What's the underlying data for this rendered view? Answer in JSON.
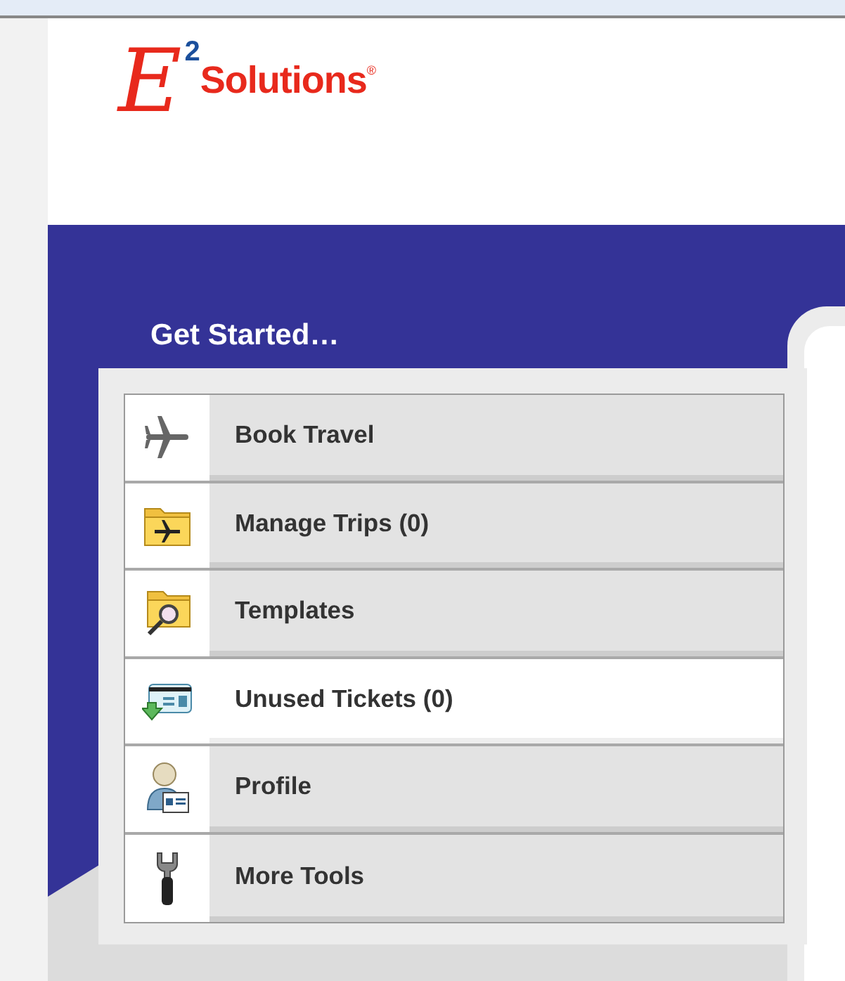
{
  "logo": {
    "letter": "E",
    "superscript": "2",
    "name": "Solutions",
    "mark": "®"
  },
  "heading": "Get Started…",
  "menu": [
    {
      "label": "Book Travel",
      "kind": "plane",
      "selected": false
    },
    {
      "label": "Manage Trips (0)",
      "kind": "folder-plane",
      "selected": false
    },
    {
      "label": "Templates",
      "kind": "folder-search",
      "selected": false
    },
    {
      "label": "Unused Tickets (0)",
      "kind": "ticket",
      "selected": true
    },
    {
      "label": "Profile",
      "kind": "person",
      "selected": false
    },
    {
      "label": "More Tools",
      "kind": "wrench",
      "selected": false
    }
  ]
}
